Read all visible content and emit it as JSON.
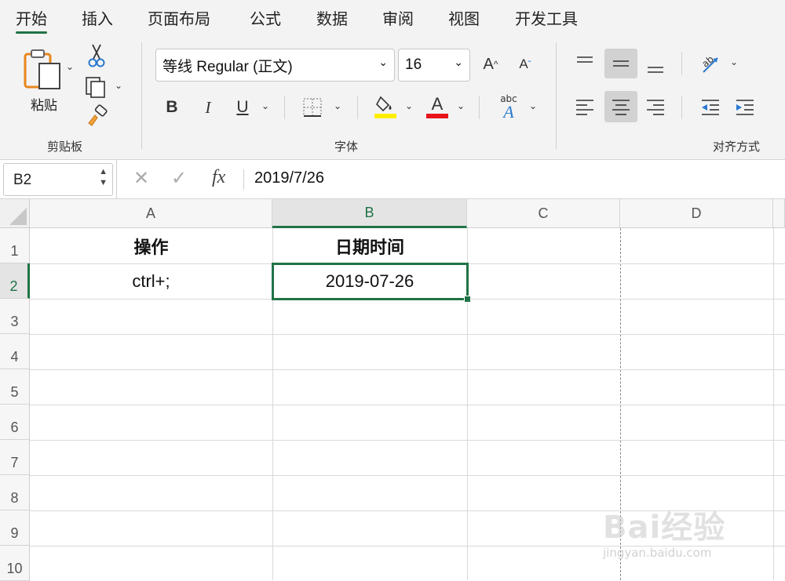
{
  "ribbon": {
    "tabs": [
      {
        "label": "开始",
        "active": true
      },
      {
        "label": "插入"
      },
      {
        "label": "页面布局"
      },
      {
        "label": "公式"
      },
      {
        "label": "数据"
      },
      {
        "label": "审阅"
      },
      {
        "label": "视图"
      },
      {
        "label": "开发工具"
      }
    ],
    "clipboard": {
      "paste_label": "粘贴",
      "group_label": "剪贴板",
      "icons": [
        "paste-icon",
        "cut-icon",
        "copy-icon",
        "format-painter-icon"
      ]
    },
    "font": {
      "family": "等线 Regular (正文)",
      "size": "16",
      "group_label": "字体",
      "bold": "B",
      "italic": "I",
      "underline": "U",
      "increase_size": "A",
      "decrease_size": "A",
      "font_color_glyph": "A",
      "phonetic_glyph": "abc",
      "fill_color": "#ffee00",
      "font_color": "#e8141b"
    },
    "alignment": {
      "group_label": "对齐方式",
      "selected_vertical": "middle",
      "selected_horizontal": "center"
    }
  },
  "formula_bar": {
    "name_box": "B2",
    "fx": "fx",
    "formula": "2019/7/26"
  },
  "sheet": {
    "columns": [
      "A",
      "B",
      "C",
      "D"
    ],
    "rows": [
      "1",
      "2",
      "3",
      "4",
      "5",
      "6",
      "7",
      "8",
      "9",
      "10"
    ],
    "selected_cell": "B2",
    "cells": {
      "A1": "操作",
      "B1": "日期时间",
      "A2": "ctrl+;",
      "B2": "2019-07-26"
    }
  },
  "watermark": {
    "text": "Bai经验",
    "url": "jingyan.baidu.com"
  },
  "colors": {
    "accent": "#217346"
  }
}
